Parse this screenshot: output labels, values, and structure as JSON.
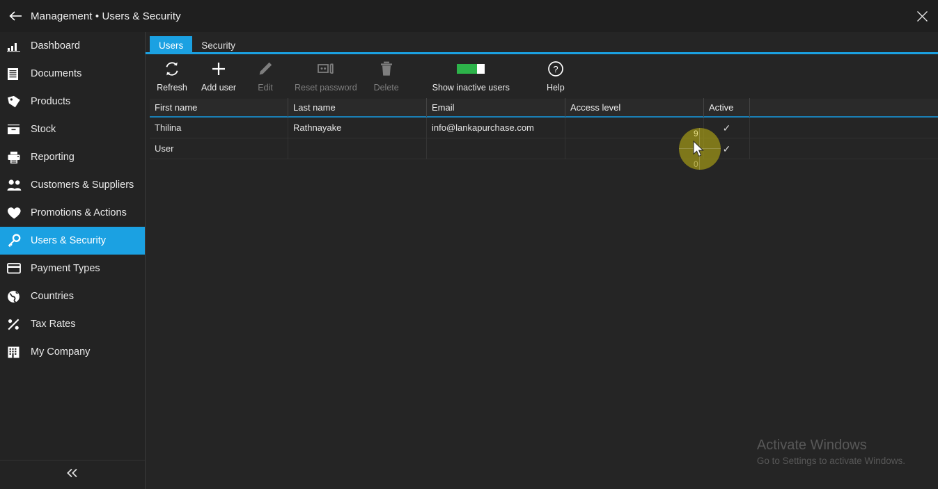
{
  "window": {
    "title": "Management • Users & Security",
    "back_icon": "arrow-left-icon",
    "close_icon": "close-icon"
  },
  "sidebar": {
    "collapse_icon": "chevron-double-left-icon",
    "items": [
      {
        "label": "Dashboard",
        "icon": "bar-chart-icon",
        "active": false
      },
      {
        "label": "Documents",
        "icon": "document-icon",
        "active": false
      },
      {
        "label": "Products",
        "icon": "tag-icon",
        "active": false
      },
      {
        "label": "Stock",
        "icon": "box-icon",
        "active": false
      },
      {
        "label": "Reporting",
        "icon": "printer-icon",
        "active": false
      },
      {
        "label": "Customers & Suppliers",
        "icon": "people-icon",
        "active": false
      },
      {
        "label": "Promotions & Actions",
        "icon": "heart-icon",
        "active": false
      },
      {
        "label": "Users & Security",
        "icon": "key-icon",
        "active": true
      },
      {
        "label": "Payment Types",
        "icon": "credit-card-icon",
        "active": false
      },
      {
        "label": "Countries",
        "icon": "globe-icon",
        "active": false
      },
      {
        "label": "Tax Rates",
        "icon": "percent-icon",
        "active": false
      },
      {
        "label": "My Company",
        "icon": "building-icon",
        "active": false
      }
    ]
  },
  "tabs": [
    {
      "label": "Users",
      "active": true
    },
    {
      "label": "Security",
      "active": false
    }
  ],
  "toolbar": {
    "buttons": [
      {
        "label": "Refresh",
        "icon": "refresh-icon",
        "enabled": true
      },
      {
        "label": "Add user",
        "icon": "plus-icon",
        "enabled": true
      },
      {
        "label": "Edit",
        "icon": "pencil-icon",
        "enabled": false
      },
      {
        "label": "Reset password",
        "icon": "reset-password-icon",
        "enabled": false
      },
      {
        "label": "Delete",
        "icon": "trash-icon",
        "enabled": false
      },
      {
        "label": "Show inactive users",
        "icon": "toggle-on-icon",
        "enabled": true
      },
      {
        "label": "Help",
        "icon": "question-circle-icon",
        "enabled": true
      }
    ]
  },
  "table": {
    "columns": [
      "First name",
      "Last name",
      "Email",
      "Access level",
      "Active"
    ],
    "rows": [
      {
        "first_name": "Thilina",
        "last_name": "Rathnayake",
        "email": "info@lankapurchase.com",
        "access_level": "",
        "active": "✓"
      },
      {
        "first_name": "User",
        "last_name": "",
        "email": "",
        "access_level": "",
        "active": "✓"
      }
    ]
  },
  "watermark": {
    "title": "Activate Windows",
    "subtitle": "Go to Settings to activate Windows."
  },
  "cursor_marker": {
    "top_value": "9",
    "bottom_value": "0"
  },
  "colors": {
    "accent": "#1ba1e2",
    "toggle_on": "#2db34a",
    "marker": "#b4aa14",
    "background": "#252525",
    "sidebar": "#232323"
  }
}
